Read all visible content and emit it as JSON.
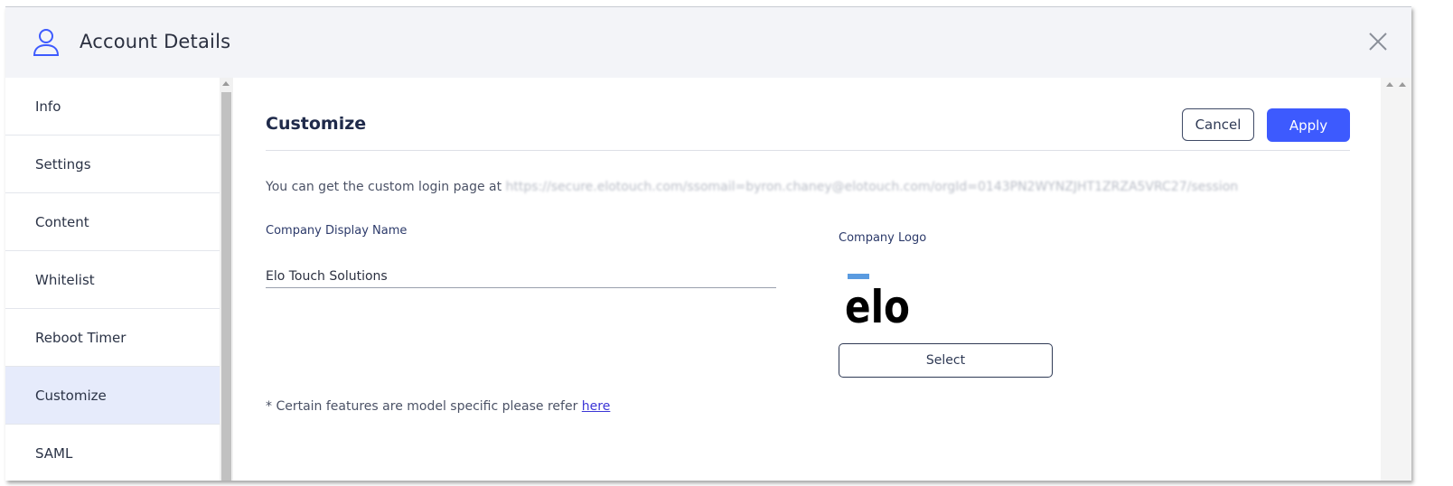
{
  "header": {
    "title": "Account Details",
    "user_icon": "user-icon",
    "close_icon": "close-icon"
  },
  "sidebar": {
    "items": [
      {
        "label": "Info"
      },
      {
        "label": "Settings"
      },
      {
        "label": "Content"
      },
      {
        "label": "Whitelist"
      },
      {
        "label": "Reboot Timer"
      },
      {
        "label": "Customize",
        "active": true
      },
      {
        "label": "SAML"
      }
    ]
  },
  "customize": {
    "title": "Customize",
    "cancel_label": "Cancel",
    "apply_label": "Apply",
    "login_text": "You can get the custom login page at",
    "login_url": "https://secure.elotouch.com/ssomail=byron.chaney@elotouch.com/orgId=0143PN2WYNZJHT1ZRZA5VRC27/session",
    "company_name_label": "Company Display Name",
    "company_name_value": "Elo Touch Solutions",
    "company_logo_label": "Company Logo",
    "logo_text": "elo",
    "select_label": "Select",
    "footnote_text": "* Certain features are model specific please refer",
    "footnote_link": "here"
  },
  "colors": {
    "accent": "#3d5afe",
    "active_item_bg": "#e6ebfb",
    "header_bg": "#f3f4f8",
    "logo_bar": "#5a9be0"
  }
}
